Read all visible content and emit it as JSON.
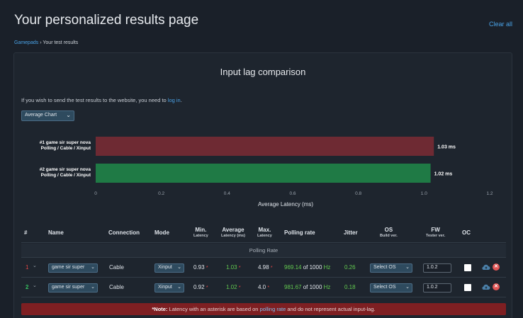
{
  "header": {
    "title": "Your personalized results page",
    "clear_all": "Clear all"
  },
  "breadcrumb": {
    "link": "Gamepads",
    "separator": "›",
    "current": "Your test results"
  },
  "panel": {
    "title": "Input lag comparison",
    "info_text": "If you wish to send the test results to the website, you need to",
    "info_link": "log in",
    "info_end": ".",
    "chart_select": "Average Chart"
  },
  "chart_data": {
    "type": "bar",
    "orientation": "horizontal",
    "categories": [
      [
        "#1 game sir super nova",
        "Polling / Cable / Xinput"
      ],
      [
        "#2 game sir super nova",
        "Polling / Cable / Xinput"
      ]
    ],
    "values": [
      1.03,
      1.02
    ],
    "value_labels": [
      "1.03 ms",
      "1.02 ms"
    ],
    "colors": [
      "#6e2a33",
      "#1f7a45"
    ],
    "xlabel": "Average Latency (ms)",
    "xlim": [
      0,
      1.2
    ],
    "xticks": [
      "0",
      "0.2",
      "0.4",
      "0.6",
      "0.8",
      "1.0",
      "1.2"
    ]
  },
  "table": {
    "headers": {
      "num": "#",
      "name": "Name",
      "connection": "Connection",
      "mode": "Mode",
      "min": "Min.",
      "min_sub": "Latency",
      "avg": "Average",
      "avg_sub": "Latency (ms)",
      "max": "Max.",
      "max_sub": "Latency",
      "polling": "Polling rate",
      "jitter": "Jitter",
      "os": "OS",
      "os_sub": "Build ver.",
      "fw": "FW",
      "fw_sub": "Tester ver.",
      "oc": "OC"
    },
    "group_label": "Polling Rate",
    "rows": [
      {
        "rank": "1",
        "name": "game sir super",
        "connection": "Cable",
        "mode": "Xinput",
        "min": "0.93",
        "avg": "1.03",
        "max": "4.98",
        "polling_value": "969.14",
        "polling_of": "of 1000",
        "polling_unit": "Hz",
        "jitter": "0.26",
        "os": "Select OS",
        "fw": "1.0.2",
        "asterisk": "*"
      },
      {
        "rank": "2",
        "name": "game sir super",
        "connection": "Cable",
        "mode": "Xinput",
        "min": "0.92",
        "avg": "1.02",
        "max": "4.0",
        "polling_value": "981.67",
        "polling_of": "of 1000",
        "polling_unit": "Hz",
        "jitter": "0.18",
        "os": "Select OS",
        "fw": "1.0.2",
        "asterisk": "*"
      }
    ]
  },
  "note": {
    "bold": "*Note:",
    "text_before": "Latency with an asterisk are based on",
    "link": "polling rate",
    "text_after": "and do not represent actual input-lag."
  },
  "icons": {
    "chevron": "⌄",
    "delete": "✕"
  }
}
